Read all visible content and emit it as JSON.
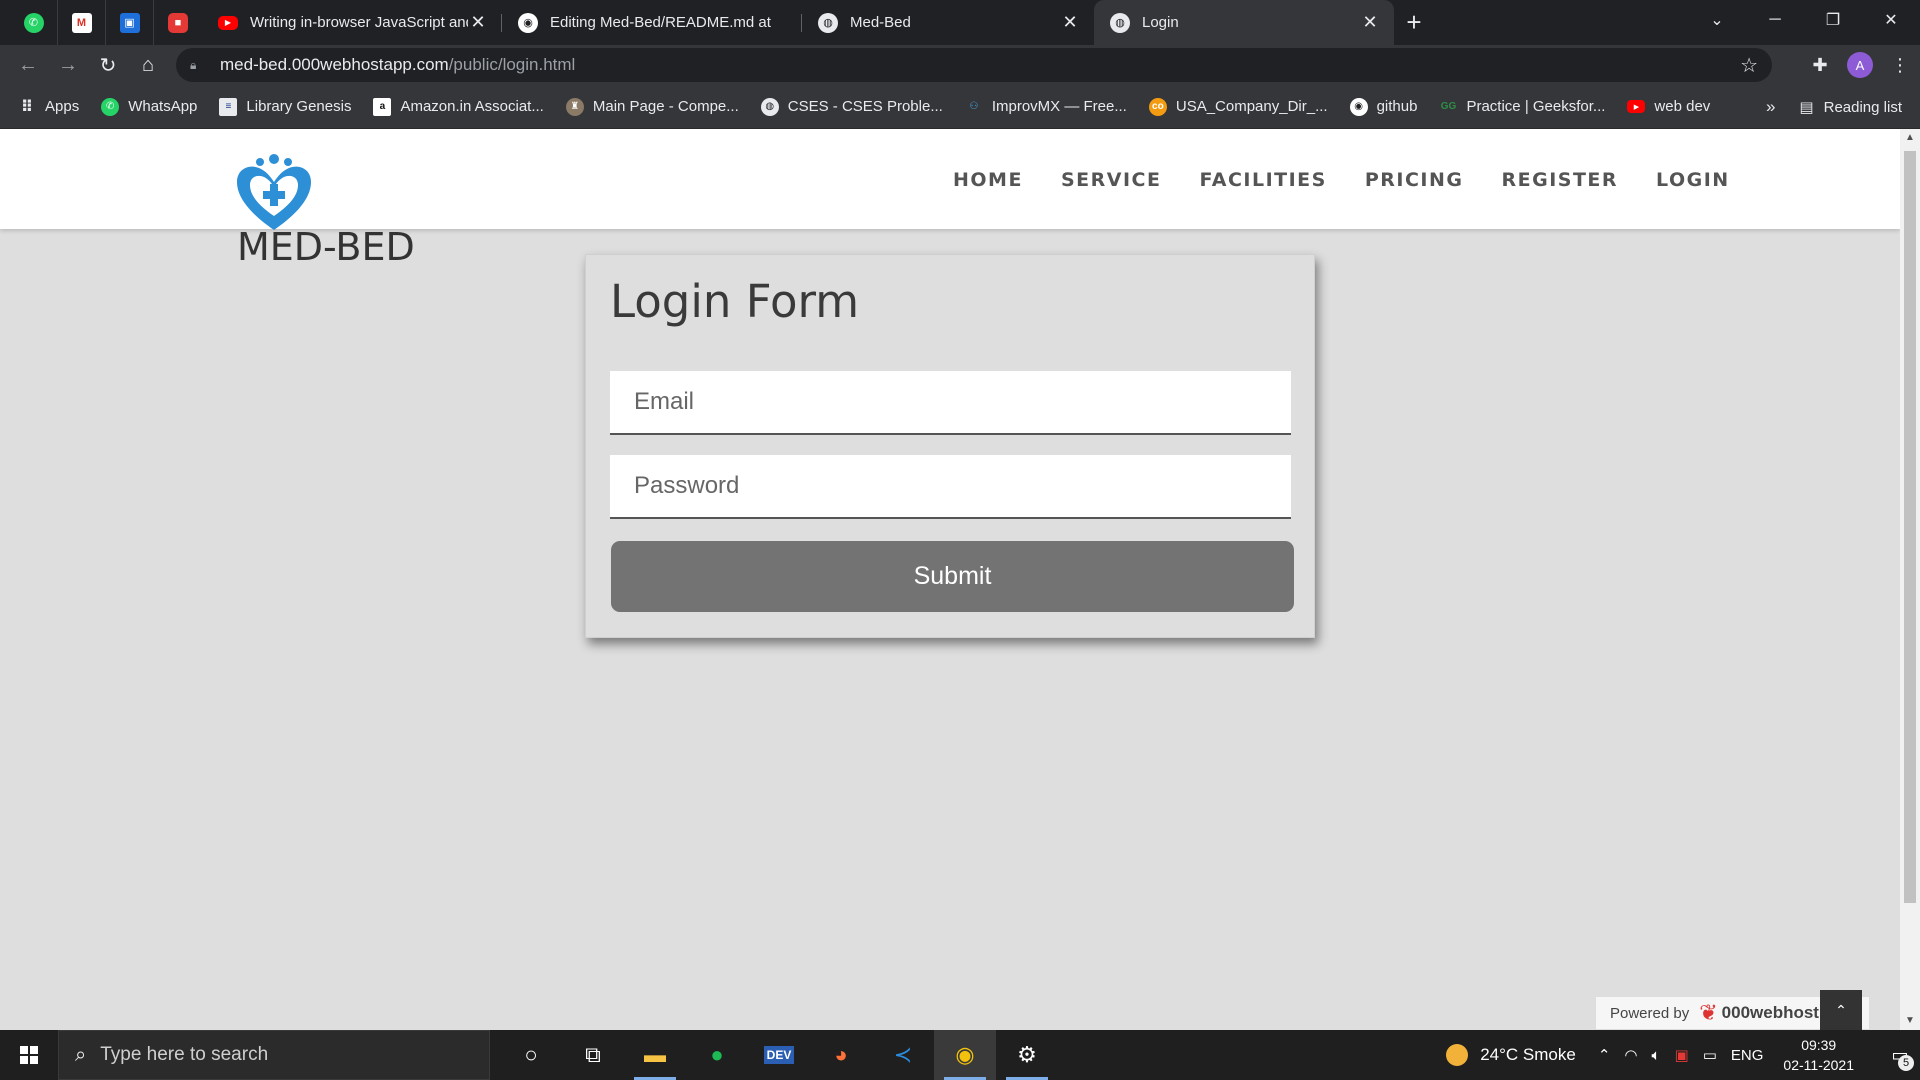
{
  "browser": {
    "tabs": [
      {
        "title": "Writing in-browser JavaScript and",
        "icon": "youtube-icon"
      },
      {
        "title": "Editing Med-Bed/README.md at",
        "icon": "github-icon"
      },
      {
        "title": "Med-Bed",
        "icon": "globe-icon"
      },
      {
        "title": "Login",
        "icon": "globe-icon",
        "active": true
      }
    ],
    "pinned_tabs": [
      "whatsapp-icon",
      "gmail-icon",
      "google-classroom-icon",
      "red-app-icon"
    ],
    "url_host": "med-bed.000webhostapp.com",
    "url_path": "/public/login.html",
    "profile_initial": "A",
    "bookmarks": [
      {
        "label": "Apps",
        "icon": "apps-grid-icon"
      },
      {
        "label": "WhatsApp",
        "icon": "whatsapp-icon"
      },
      {
        "label": "Library Genesis",
        "icon": "library-genesis-icon"
      },
      {
        "label": "Amazon.in Associat...",
        "icon": "amazon-icon"
      },
      {
        "label": "Main Page - Compe...",
        "icon": "wiki-icon"
      },
      {
        "label": "CSES - CSES Proble...",
        "icon": "globe-icon"
      },
      {
        "label": "ImprovMX — Free...",
        "icon": "improvmx-icon"
      },
      {
        "label": "USA_Company_Dir_...",
        "icon": "directory-icon"
      },
      {
        "label": "github",
        "icon": "github-icon"
      },
      {
        "label": "Practice | Geeksfor...",
        "icon": "geeksforgeeks-icon"
      },
      {
        "label": "web dev",
        "icon": "youtube-icon"
      }
    ],
    "reading_list": "Reading list"
  },
  "site": {
    "brand": "MED-BED",
    "nav": [
      "HOME",
      "SERVICE",
      "FACILITIES",
      "PRICING",
      "REGISTER",
      "LOGIN"
    ],
    "form": {
      "title": "Login Form",
      "email_placeholder": "Email",
      "password_placeholder": "Password",
      "submit": "Submit"
    },
    "powered_by": "Powered by",
    "host_name": "000webhost"
  },
  "taskbar": {
    "search_placeholder": "Type here to search",
    "apps": [
      "cortana-icon",
      "task-view-icon",
      "file-explorer-icon",
      "spotify-icon",
      "dev-icon",
      "firefox-icon",
      "vscode-icon",
      "chrome-icon",
      "settings-icon"
    ],
    "weather": "24°C  Smoke",
    "language": "ENG",
    "time": "09:39",
    "date": "02-11-2021",
    "notification_count": "5"
  },
  "colors": {
    "page_bg": "#dedede",
    "submit_bg": "#737373",
    "logo_blue": "#2d8fd5",
    "chrome_dark": "#202124"
  }
}
